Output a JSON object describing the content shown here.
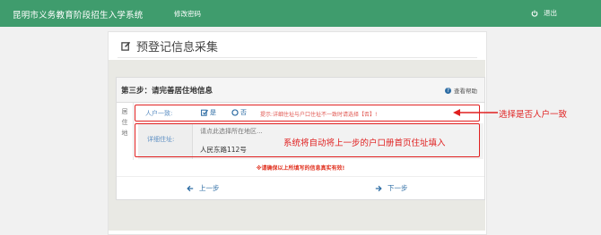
{
  "header": {
    "app_title": "昆明市义务教育阶段招生入学系统",
    "change_password": "修改密码",
    "logout": "退出"
  },
  "page": {
    "title": "预登记信息采集"
  },
  "step": {
    "title": "第三步：请完善居住地信息",
    "help_label": "查看帮助",
    "side_label": "居住地",
    "consistent_label": "人户一致:",
    "option_yes": "是",
    "option_no": "否",
    "hint": "提示:详细住址与户口住址不一致时请选择【否】!",
    "address_label": "详细住址:",
    "address_placeholder": "请点此选择所在地区...",
    "address_value": "人民东路112号",
    "warning": "※请确保以上所填写的信息真实有效!",
    "prev_label": "上一步",
    "next_label": "下一步"
  },
  "annotations": {
    "consistency": "选择是否人户一致",
    "address_autofill": "系统将自动将上一步的户口册首页住址填入"
  },
  "colors": {
    "topbar": "#3f9c6d",
    "link": "#2e6da4",
    "annotation": "#e02020"
  }
}
